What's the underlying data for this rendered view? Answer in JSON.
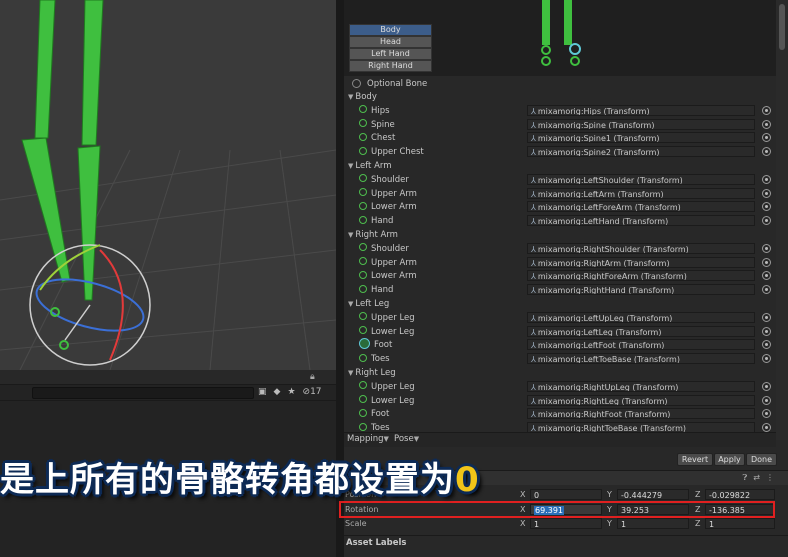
{
  "scene": {
    "toolbar": {
      "lock_icon": "lock-icon",
      "search_placeholder": "",
      "hidden_count": "17"
    }
  },
  "preview": {
    "body_parts": [
      "Body",
      "Head",
      "Left Hand",
      "Right Hand"
    ],
    "active_part": "Body"
  },
  "optional_bone_label": "Optional Bone",
  "groups": [
    {
      "name": "Body",
      "bones": [
        {
          "label": "Hips",
          "value": "mixamorig:Hips (Transform)"
        },
        {
          "label": "Spine",
          "value": "mixamorig:Spine (Transform)"
        },
        {
          "label": "Chest",
          "value": "mixamorig:Spine1 (Transform)"
        },
        {
          "label": "Upper Chest",
          "value": "mixamorig:Spine2 (Transform)"
        }
      ]
    },
    {
      "name": "Left Arm",
      "bones": [
        {
          "label": "Shoulder",
          "value": "mixamorig:LeftShoulder (Transform)"
        },
        {
          "label": "Upper Arm",
          "value": "mixamorig:LeftArm (Transform)"
        },
        {
          "label": "Lower Arm",
          "value": "mixamorig:LeftForeArm (Transform)"
        },
        {
          "label": "Hand",
          "value": "mixamorig:LeftHand (Transform)"
        }
      ]
    },
    {
      "name": "Right Arm",
      "bones": [
        {
          "label": "Shoulder",
          "value": "mixamorig:RightShoulder (Transform)"
        },
        {
          "label": "Upper Arm",
          "value": "mixamorig:RightArm (Transform)"
        },
        {
          "label": "Lower Arm",
          "value": "mixamorig:RightForeArm (Transform)"
        },
        {
          "label": "Hand",
          "value": "mixamorig:RightHand (Transform)"
        }
      ]
    },
    {
      "name": "Left Leg",
      "bones": [
        {
          "label": "Upper Leg",
          "value": "mixamorig:LeftUpLeg (Transform)"
        },
        {
          "label": "Lower Leg",
          "value": "mixamorig:LeftLeg (Transform)"
        },
        {
          "label": "Foot",
          "value": "mixamorig:LeftFoot (Transform)"
        },
        {
          "label": "Toes",
          "value": "mixamorig:LeftToeBase (Transform)"
        }
      ]
    },
    {
      "name": "Right Leg",
      "bones": [
        {
          "label": "Upper Leg",
          "value": "mixamorig:RightUpLeg (Transform)"
        },
        {
          "label": "Lower Leg",
          "value": "mixamorig:RightLeg (Transform)"
        },
        {
          "label": "Foot",
          "value": "mixamorig:RightFoot (Transform)"
        },
        {
          "label": "Toes",
          "value": "mixamorig:RightToeBase (Transform)"
        }
      ]
    }
  ],
  "tabs": {
    "mapping": "Mapping",
    "pose": "Pose"
  },
  "buttons": {
    "revert": "Revert",
    "apply": "Apply",
    "done": "Done"
  },
  "transform": {
    "position": {
      "label": "Position",
      "x": "0",
      "y": "-0.444279",
      "z": "-0.029822"
    },
    "rotation": {
      "label": "Rotation",
      "x": "69.391",
      "y": "39.253",
      "z": "-136.385"
    },
    "scale": {
      "label": "Scale",
      "x": "1",
      "y": "1",
      "z": "1"
    }
  },
  "asset_labels": "Asset Labels",
  "subtitle": {
    "text": "是上所有的骨骼转角都设置为",
    "zero": "0"
  },
  "colors": {
    "bone_green": "#4dbd4d",
    "highlight_red": "#e02020",
    "selection_blue": "#2a6fb8"
  }
}
